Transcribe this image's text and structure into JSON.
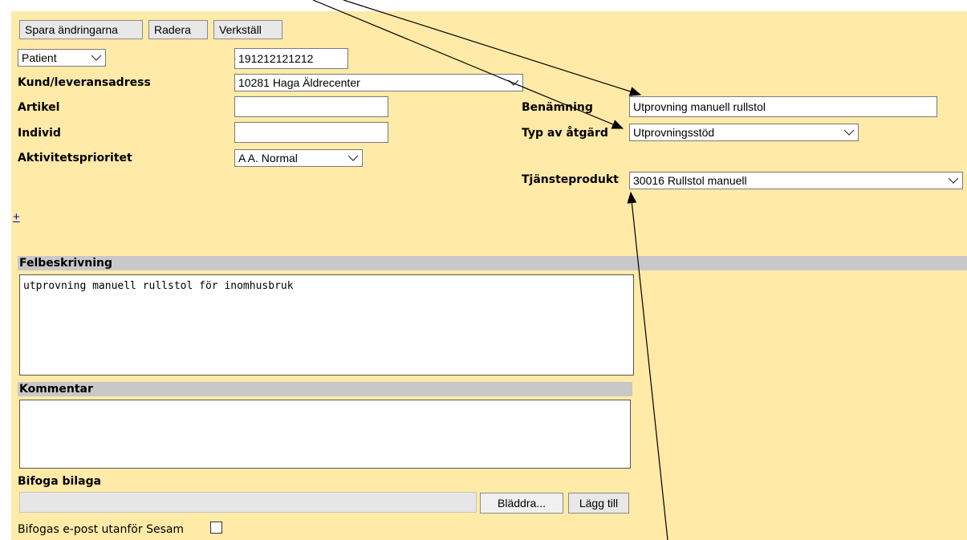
{
  "toolbar": {
    "save": "Spara ändringarna",
    "delete": "Radera",
    "apply": "Verkställ"
  },
  "patient_type": {
    "selected": "Patient"
  },
  "patient_id": {
    "value": "191212121212"
  },
  "labels": {
    "address": "Kund/leveransadress",
    "article": "Artikel",
    "individual": "Individ",
    "priority": "Aktivitetsprioritet",
    "designation": "Benämning",
    "action_type": "Typ av åtgärd",
    "service_product": "Tjänsteprodukt",
    "fault_description": "Felbeskrivning",
    "comment": "Kommentar",
    "attach": "Bifoga bilaga",
    "email_outside": "Bifogas e-post utanför Sesam"
  },
  "fields": {
    "address": "10281 Haga Äldrecenter",
    "article": "",
    "individual": "",
    "priority": "A A. Normal",
    "designation": "Utprovning manuell rullstol",
    "action_type": "Utprovningsstöd",
    "service_product": "30016 Rullstol manuell",
    "fault_description": "utprovning manuell rullstol för inomhusbruk",
    "comment": ""
  },
  "add_link": "+",
  "attachment": {
    "browse": "Bläddra...",
    "add": "Lägg till"
  },
  "colors": {
    "panel": "#ffeaa8",
    "section": "#c8c8c8",
    "link": "#0000cc"
  }
}
